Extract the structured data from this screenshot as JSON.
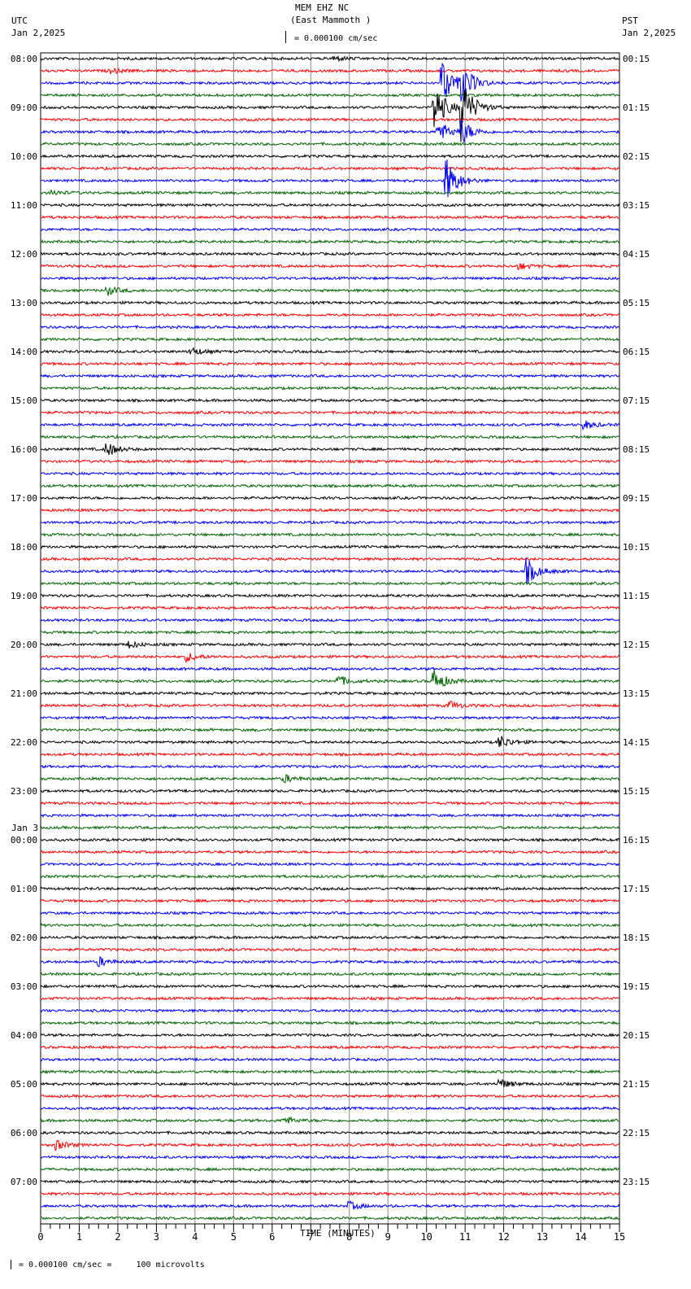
{
  "header": {
    "title": "MEM EHZ NC",
    "subtitle": "(East Mammoth )",
    "left_tz": "UTC",
    "left_date": "Jan 2,2025",
    "right_tz": "PST",
    "right_date": "Jan 2,2025",
    "scale_label": "= 0.000100 cm/sec"
  },
  "footer": {
    "scale_label": "= 0.000100 cm/sec =     100 microvolts"
  },
  "chart_data": {
    "type": "line",
    "title": "MEM EHZ NC (East Mammoth )",
    "xlabel": "TIME (MINUTES)",
    "xlim": [
      0,
      15
    ],
    "x_ticks": [
      "0",
      "1",
      "2",
      "3",
      "4",
      "5",
      "6",
      "7",
      "8",
      "9",
      "10",
      "11",
      "12",
      "13",
      "14",
      "15"
    ],
    "traces_per_hour": 4,
    "trace_count": 96,
    "trace_colors": [
      "#000000",
      "#ff0000",
      "#0000ff",
      "#006400"
    ],
    "grid": true,
    "left_labels": [
      "08:00",
      "09:00",
      "10:00",
      "11:00",
      "12:00",
      "13:00",
      "14:00",
      "15:00",
      "16:00",
      "17:00",
      "18:00",
      "19:00",
      "20:00",
      "21:00",
      "22:00",
      "23:00",
      "00:00",
      "01:00",
      "02:00",
      "03:00",
      "04:00",
      "05:00",
      "06:00",
      "07:00"
    ],
    "date_change_label": "Jan 3",
    "right_labels": [
      "00:15",
      "01:15",
      "02:15",
      "03:15",
      "04:15",
      "05:15",
      "06:15",
      "07:15",
      "08:15",
      "09:15",
      "10:15",
      "11:15",
      "12:15",
      "13:15",
      "14:15",
      "15:15",
      "16:15",
      "17:15",
      "18:15",
      "19:15",
      "20:15",
      "21:15",
      "22:15",
      "23:15"
    ],
    "events": [
      {
        "trace": 0,
        "minute": 7.6,
        "amp": 3
      },
      {
        "trace": 1,
        "minute": 1.8,
        "amp": 3
      },
      {
        "trace": 2,
        "minute": 10.4,
        "amp": 30
      },
      {
        "trace": 2,
        "minute": 10.9,
        "amp": 25
      },
      {
        "trace": 4,
        "minute": 10.2,
        "amp": 30
      },
      {
        "trace": 4,
        "minute": 10.9,
        "amp": 40
      },
      {
        "trace": 6,
        "minute": 10.3,
        "amp": 15
      },
      {
        "trace": 6,
        "minute": 10.9,
        "amp": 15
      },
      {
        "trace": 10,
        "minute": 10.5,
        "amp": 30
      },
      {
        "trace": 11,
        "minute": 0.3,
        "amp": 3
      },
      {
        "trace": 19,
        "minute": 1.7,
        "amp": 6
      },
      {
        "trace": 17,
        "minute": 12.4,
        "amp": 4
      },
      {
        "trace": 24,
        "minute": 3.9,
        "amp": 5
      },
      {
        "trace": 30,
        "minute": 14.1,
        "amp": 5
      },
      {
        "trace": 32,
        "minute": 1.7,
        "amp": 9
      },
      {
        "trace": 42,
        "minute": 12.6,
        "amp": 16
      },
      {
        "trace": 48,
        "minute": 2.3,
        "amp": 4
      },
      {
        "trace": 49,
        "minute": 3.8,
        "amp": 5
      },
      {
        "trace": 51,
        "minute": 7.7,
        "amp": 7
      },
      {
        "trace": 51,
        "minute": 10.2,
        "amp": 14
      },
      {
        "trace": 53,
        "minute": 10.6,
        "amp": 5
      },
      {
        "trace": 56,
        "minute": 11.9,
        "amp": 8
      },
      {
        "trace": 59,
        "minute": 6.3,
        "amp": 5
      },
      {
        "trace": 74,
        "minute": 1.5,
        "amp": 6
      },
      {
        "trace": 84,
        "minute": 11.9,
        "amp": 6
      },
      {
        "trace": 87,
        "minute": 6.3,
        "amp": 5
      },
      {
        "trace": 89,
        "minute": 0.4,
        "amp": 6
      },
      {
        "trace": 94,
        "minute": 8.0,
        "amp": 5
      }
    ]
  }
}
